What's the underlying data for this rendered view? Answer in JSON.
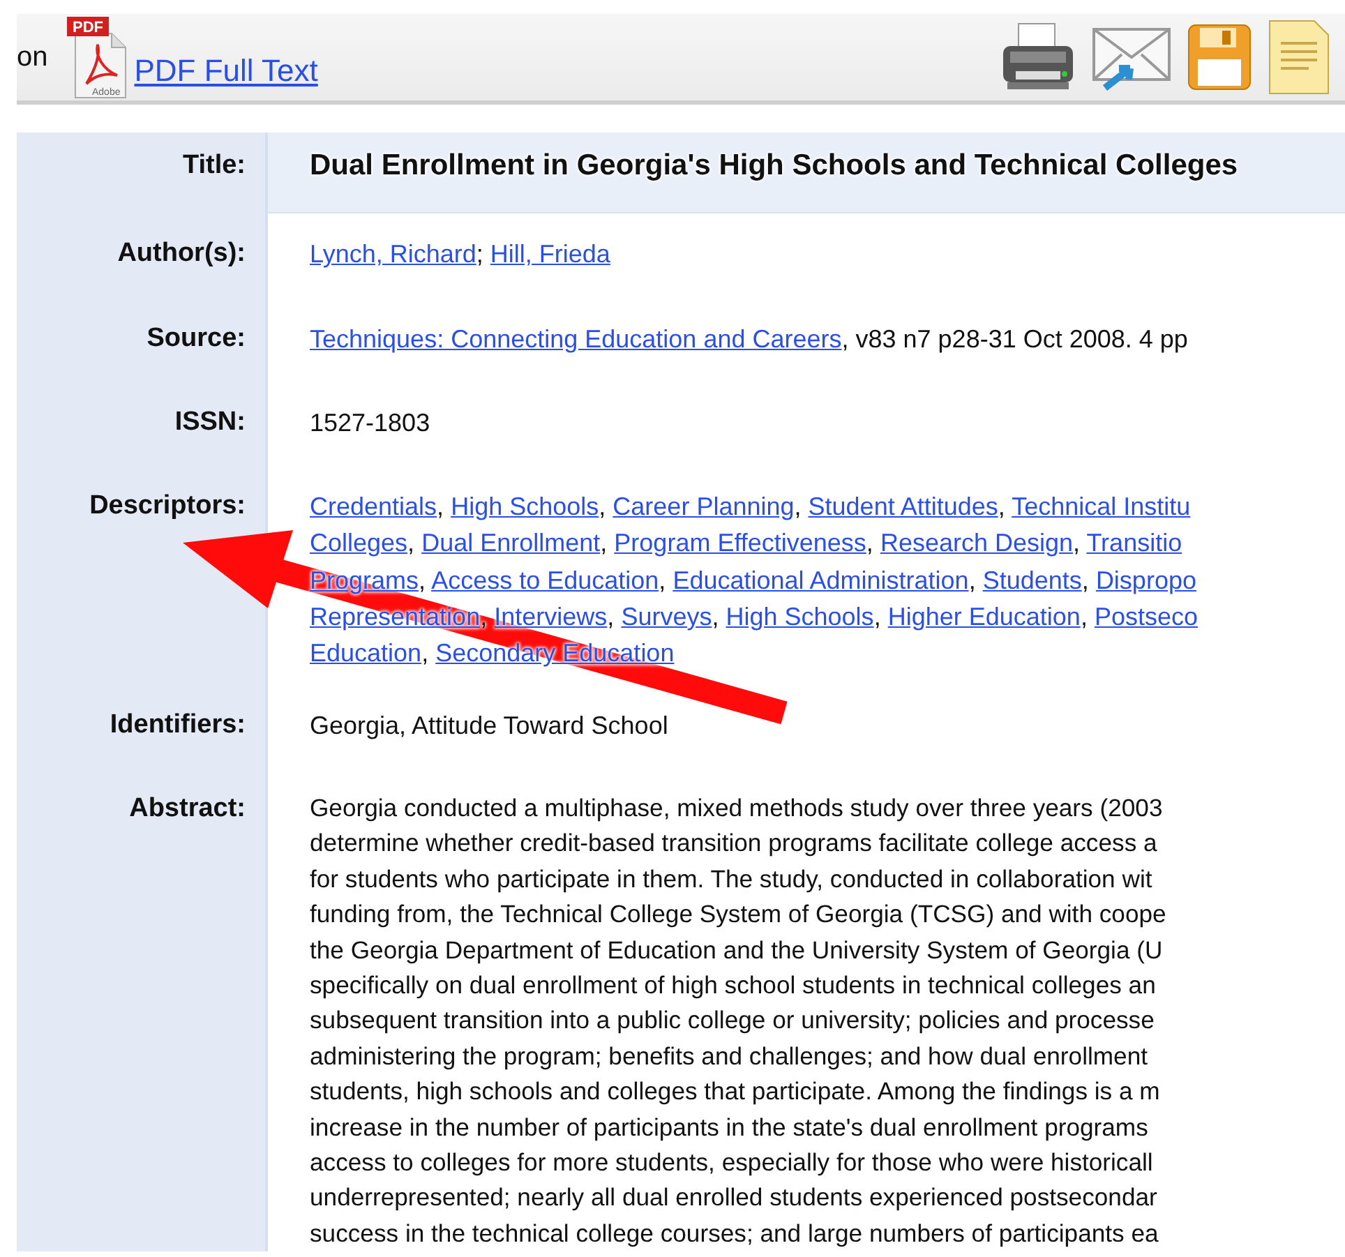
{
  "toolbar": {
    "cut_label": "on",
    "pdf_badge": "PDF",
    "pdf_maker": "Adobe",
    "pdf_link": "PDF Full Text"
  },
  "record": [
    {
      "kind": "title",
      "label": "Title:",
      "text": "Dual Enrollment in Georgia's High Schools and Technical Colleges"
    },
    {
      "kind": "links",
      "label": "Author(s):",
      "separator": "; ",
      "lines": [
        [
          "Lynch, Richard",
          "Hill, Frieda"
        ]
      ]
    },
    {
      "kind": "source",
      "label": "Source:",
      "link": "Techniques: Connecting Education and Careers",
      "text": ", v83 n7 p28-31 Oct 2008. 4 pp"
    },
    {
      "kind": "text",
      "label": "ISSN:",
      "lines": [
        "1527-1803"
      ]
    },
    {
      "kind": "links",
      "label": "Descriptors:",
      "separator": ", ",
      "lines": [
        [
          "Credentials",
          "High Schools",
          "Career Planning",
          "Student Attitudes",
          "Technical Institu"
        ],
        [
          "Colleges",
          "Dual Enrollment",
          "Program Effectiveness",
          "Research Design",
          "Transitio"
        ],
        [
          "Programs",
          "Access to Education",
          "Educational Administration",
          "Students",
          "Dispropo"
        ],
        [
          "Representation",
          "Interviews",
          "Surveys",
          "High Schools",
          "Higher Education",
          "Postseco"
        ],
        [
          "Education",
          "Secondary Education"
        ]
      ]
    },
    {
      "kind": "text",
      "label": "Identifiers:",
      "lines": [
        "Georgia, Attitude Toward School"
      ]
    },
    {
      "kind": "text",
      "label": "Abstract:",
      "lines": [
        "Georgia conducted a multiphase, mixed methods study over three years (2003",
        "determine whether credit-based transition programs facilitate college access a",
        "for students who participate in them. The study, conducted in collaboration wit",
        "funding from, the Technical College System of Georgia (TCSG) and with coope",
        "the Georgia Department of Education and the University System of Georgia (U",
        "specifically on dual enrollment of high school students in technical colleges an",
        "subsequent transition into a public college or university; policies and processe",
        "administering the program; benefits and challenges; and how dual enrollment",
        "students, high schools and colleges that participate. Among the findings is a m",
        "increase in the number of participants in the state's dual enrollment programs",
        "access to colleges for more students, especially for those who were historicall",
        "underrepresented; nearly all dual enrolled students experienced postsecondar",
        "success in the technical college courses; and large numbers of participants ea"
      ]
    }
  ]
}
